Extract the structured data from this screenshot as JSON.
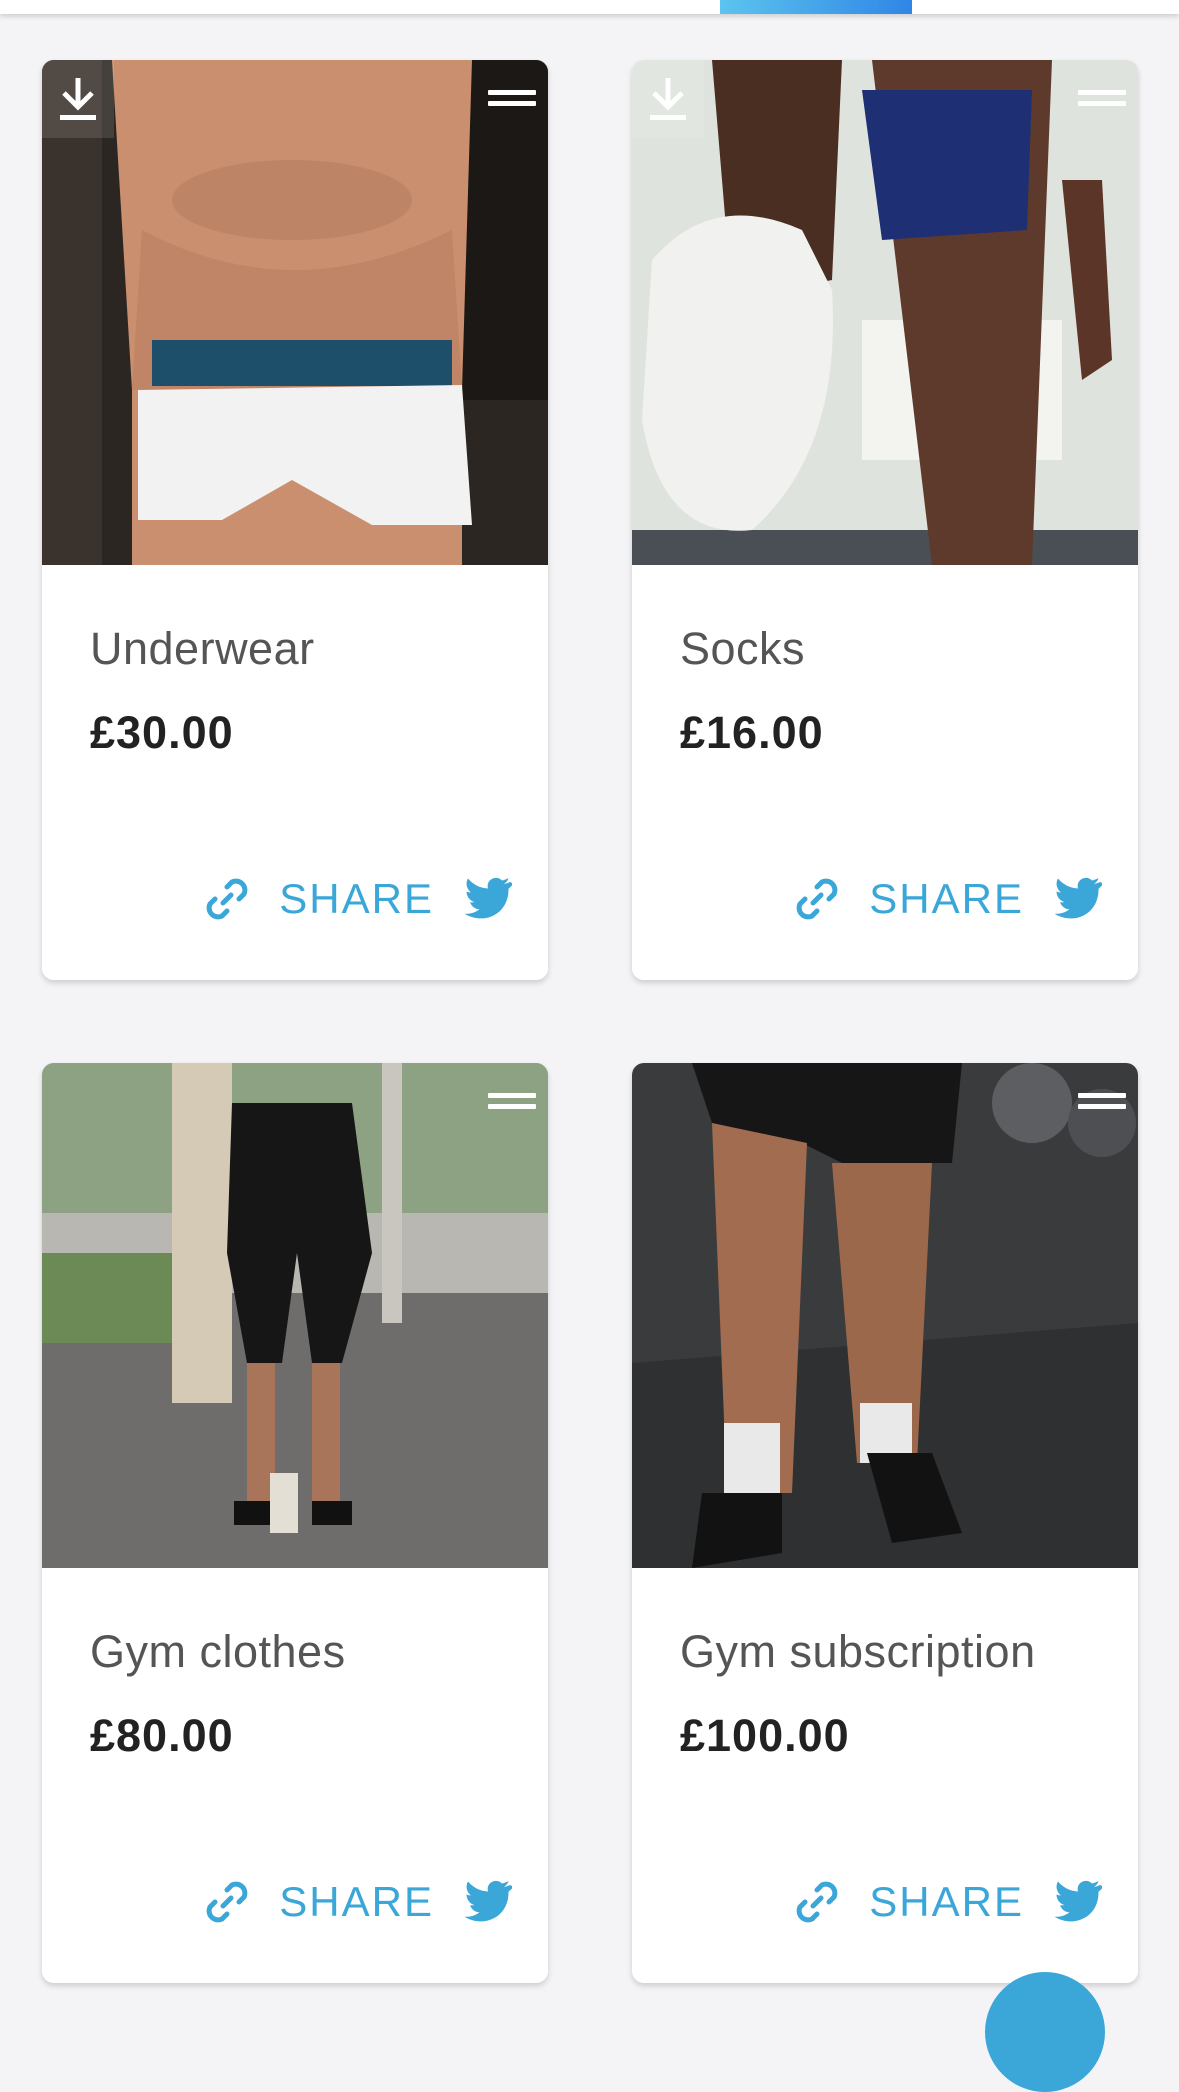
{
  "app": {
    "accent_color": "#3aa7d8",
    "share_label": "SHARE"
  },
  "products": [
    {
      "name": "Underwear",
      "price": "£30.00",
      "image": "underwear-photo",
      "has_download": true,
      "has_menu": true
    },
    {
      "name": "Socks",
      "price": "£16.00",
      "image": "socks-photo",
      "has_download": true,
      "has_menu": true
    },
    {
      "name": "Gym clothes",
      "price": "£80.00",
      "image": "gym-clothes-photo",
      "has_download": false,
      "has_menu": true
    },
    {
      "name": "Gym subscription",
      "price": "£100.00",
      "image": "gym-subscription-photo",
      "has_download": false,
      "has_menu": true
    }
  ]
}
